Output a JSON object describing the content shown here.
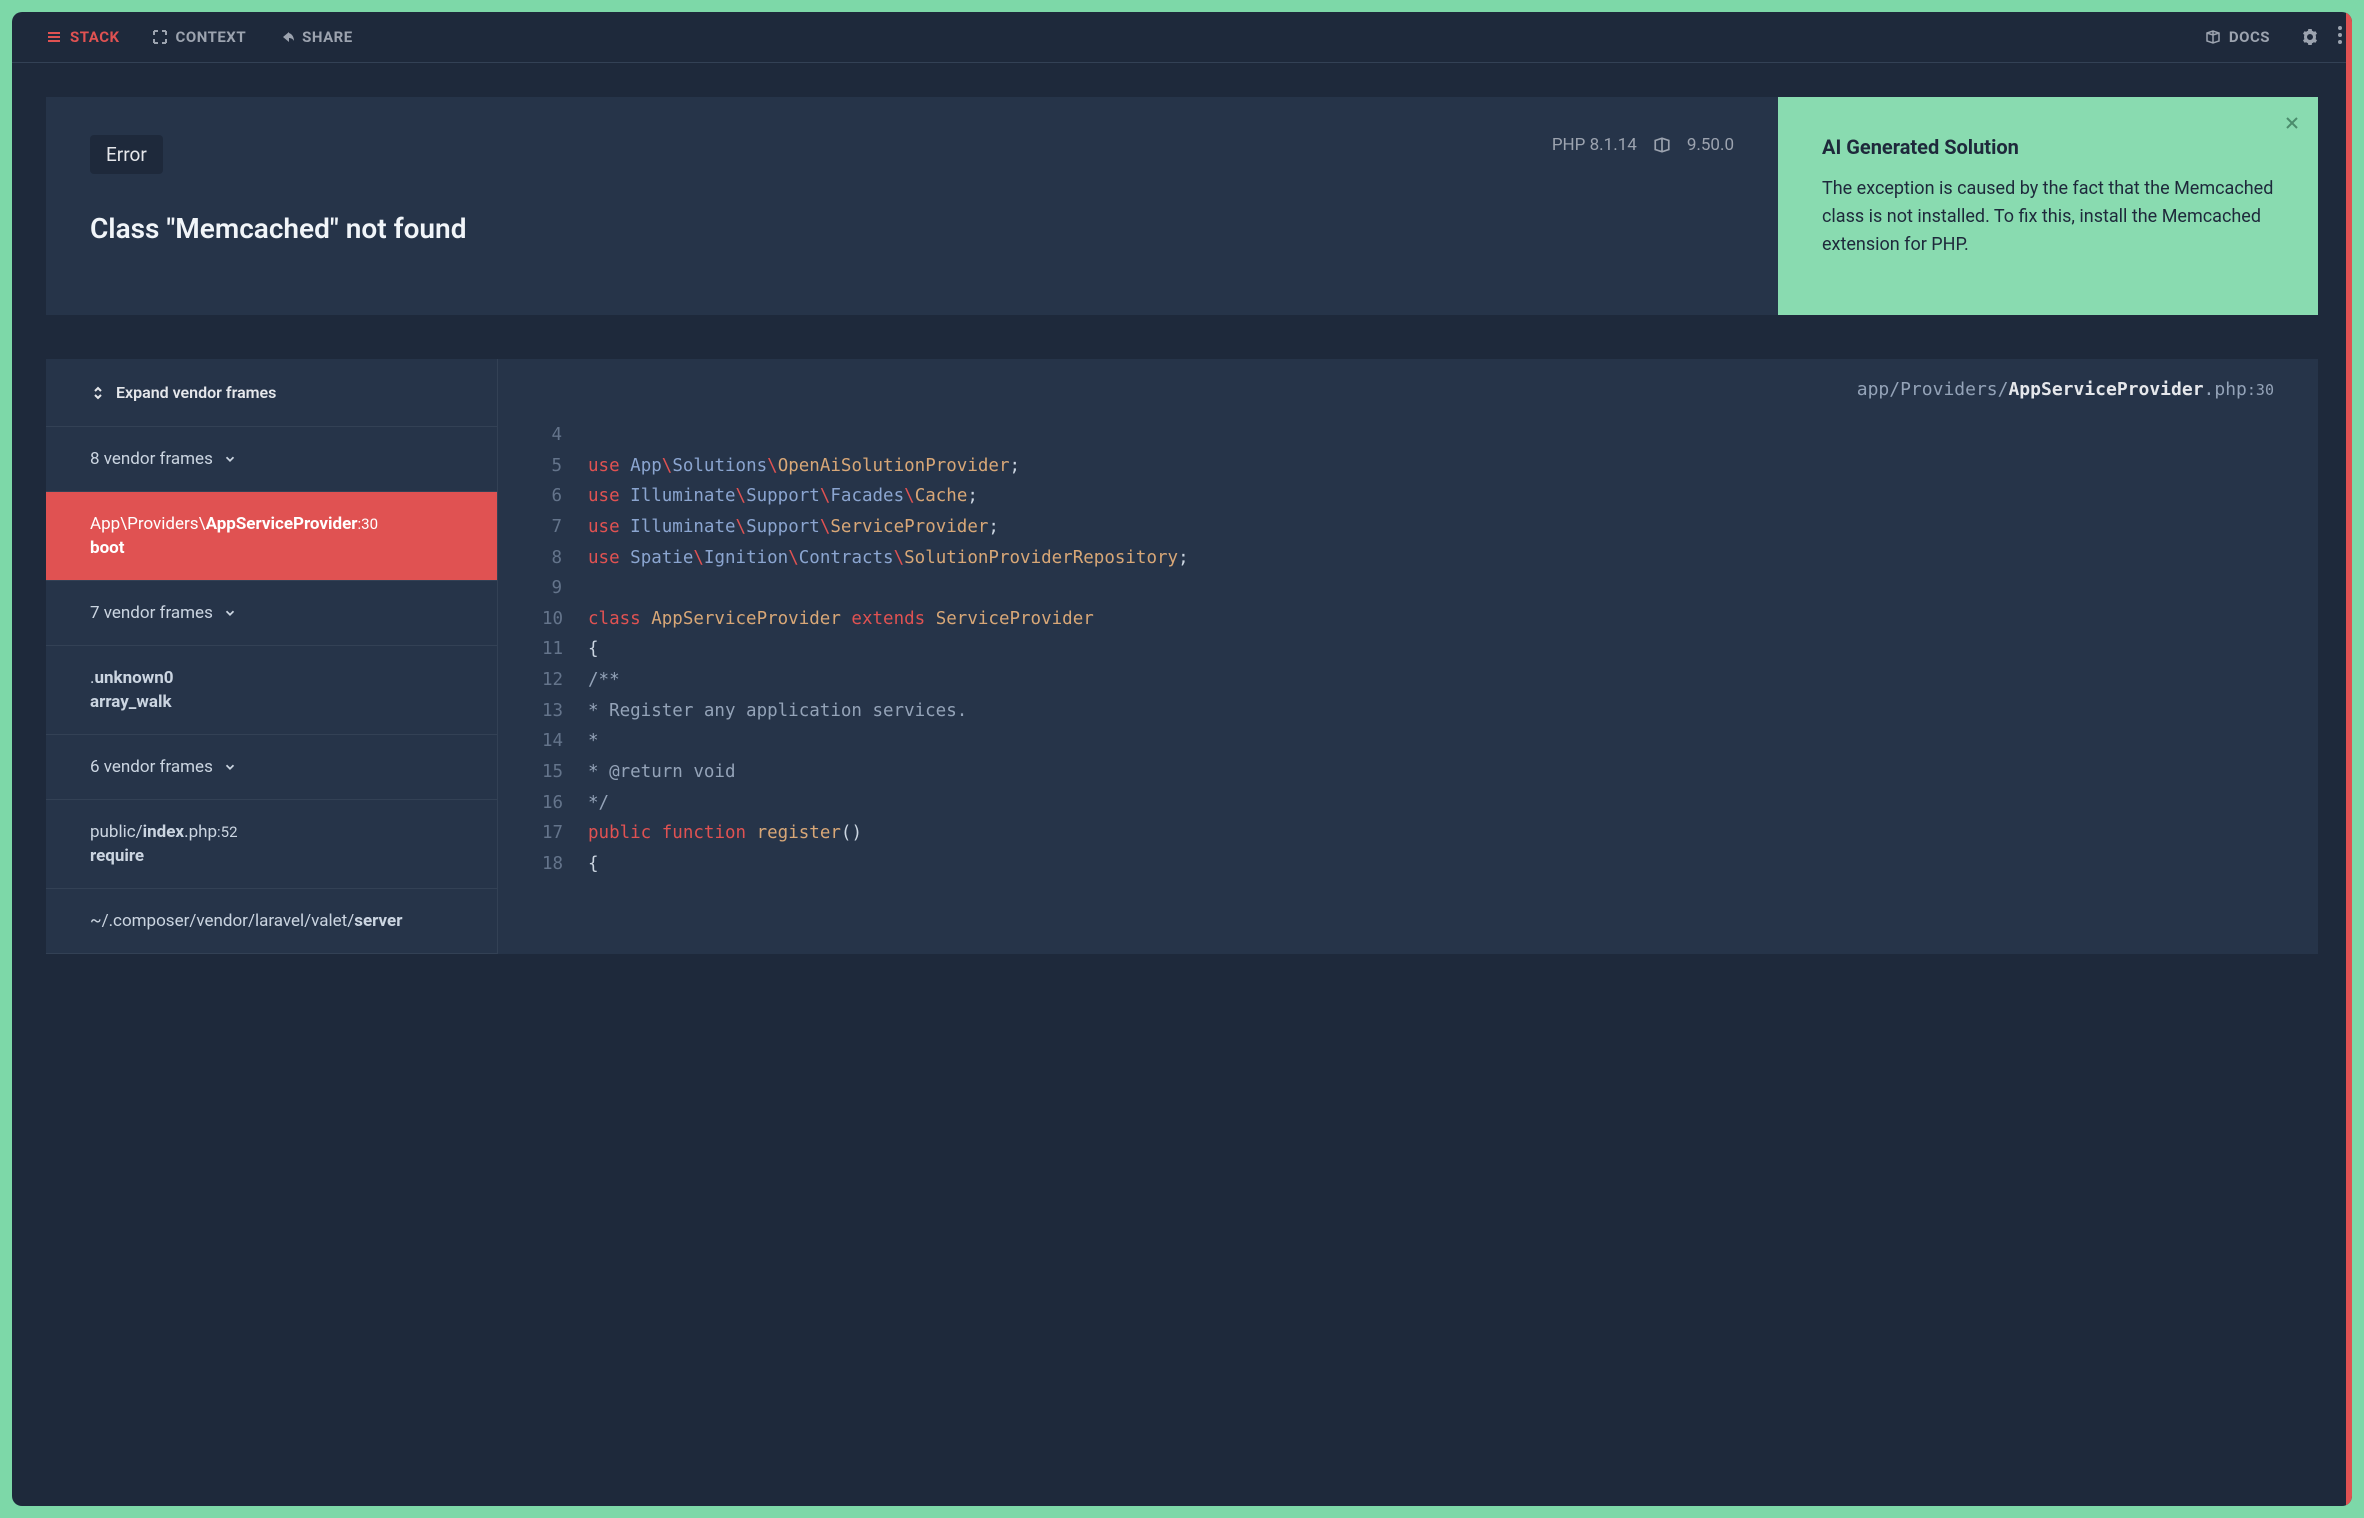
{
  "nav": {
    "stack": "STACK",
    "context": "CONTEXT",
    "share": "SHARE",
    "docs": "DOCS"
  },
  "error": {
    "badge": "Error",
    "php_version": "PHP 8.1.14",
    "laravel_version": "9.50.0",
    "title": "Class \"Memcached\" not found"
  },
  "solution": {
    "heading": "AI Generated Solution",
    "body": "The exception is caused by the fact that the Memcached class is not installed. To fix this, install the Memcached extension for PHP."
  },
  "frames": {
    "expand_label": "Expand vendor frames",
    "items": [
      {
        "type": "group",
        "label": "8 vendor frames"
      },
      {
        "type": "frame",
        "selected": true,
        "path_pre": "App\\",
        "path_mid": "Providers\\",
        "path_strong": "AppServiceProvider",
        "line": ":30",
        "func": "boot"
      },
      {
        "type": "group",
        "label": "7 vendor frames"
      },
      {
        "type": "frame",
        "path_pre": "",
        "path_mid": ".",
        "path_strong": "unknown0",
        "line": "",
        "func": "array_walk"
      },
      {
        "type": "group",
        "label": "6 vendor frames"
      },
      {
        "type": "frame",
        "path_pre": "public/",
        "path_mid": "",
        "path_strong": "index",
        "suffix": ".php",
        "line": ":52",
        "func": "require"
      },
      {
        "type": "frame",
        "path_pre": "~/.composer/vendor/laravel/valet/",
        "path_mid": "",
        "path_strong": "server",
        "suffix": "",
        "line": "",
        "func": ""
      }
    ]
  },
  "code": {
    "path_pre": "app/Providers/",
    "path_strong": "AppServiceProvider",
    "path_suffix": ".php",
    "path_line": ":30",
    "lines": [
      {
        "n": 4,
        "raw": ""
      },
      {
        "n": 5,
        "tokens": [
          [
            "kw",
            "use "
          ],
          [
            "ns",
            "App"
          ],
          [
            "bs",
            "\\"
          ],
          [
            "ns",
            "Solutions"
          ],
          [
            "bs",
            "\\"
          ],
          [
            "cls",
            "OpenAiSolutionProvider"
          ],
          [
            "punct",
            ";"
          ]
        ]
      },
      {
        "n": 6,
        "tokens": [
          [
            "kw",
            "use "
          ],
          [
            "ns",
            "Illuminate"
          ],
          [
            "bs",
            "\\"
          ],
          [
            "ns",
            "Support"
          ],
          [
            "bs",
            "\\"
          ],
          [
            "ns",
            "Facades"
          ],
          [
            "bs",
            "\\"
          ],
          [
            "cls",
            "Cache"
          ],
          [
            "punct",
            ";"
          ]
        ]
      },
      {
        "n": 7,
        "tokens": [
          [
            "kw",
            "use "
          ],
          [
            "ns",
            "Illuminate"
          ],
          [
            "bs",
            "\\"
          ],
          [
            "ns",
            "Support"
          ],
          [
            "bs",
            "\\"
          ],
          [
            "cls",
            "ServiceProvider"
          ],
          [
            "punct",
            ";"
          ]
        ]
      },
      {
        "n": 8,
        "tokens": [
          [
            "kw",
            "use "
          ],
          [
            "ns",
            "Spatie"
          ],
          [
            "bs",
            "\\"
          ],
          [
            "ns",
            "Ignition"
          ],
          [
            "bs",
            "\\"
          ],
          [
            "ns",
            "Contracts"
          ],
          [
            "bs",
            "\\"
          ],
          [
            "cls",
            "SolutionProviderRepository"
          ],
          [
            "punct",
            ";"
          ]
        ]
      },
      {
        "n": 9,
        "raw": ""
      },
      {
        "n": 10,
        "tokens": [
          [
            "kw",
            "class "
          ],
          [
            "cls",
            "AppServiceProvider"
          ],
          [
            "punct",
            " "
          ],
          [
            "kw",
            "extends"
          ],
          [
            "punct",
            " "
          ],
          [
            "cls",
            "ServiceProvider"
          ]
        ]
      },
      {
        "n": 11,
        "tokens": [
          [
            "punct",
            "{"
          ]
        ]
      },
      {
        "n": 12,
        "tokens": [
          [
            "com",
            "    /**"
          ]
        ]
      },
      {
        "n": 13,
        "tokens": [
          [
            "com",
            "     * Register any application services."
          ]
        ]
      },
      {
        "n": 14,
        "tokens": [
          [
            "com",
            "     *"
          ]
        ]
      },
      {
        "n": 15,
        "tokens": [
          [
            "com",
            "     * @return void"
          ]
        ]
      },
      {
        "n": 16,
        "tokens": [
          [
            "com",
            "     */"
          ]
        ]
      },
      {
        "n": 17,
        "tokens": [
          [
            "punct",
            "    "
          ],
          [
            "kw",
            "public"
          ],
          [
            "punct",
            " "
          ],
          [
            "kw",
            "function"
          ],
          [
            "punct",
            " "
          ],
          [
            "fn",
            "register"
          ],
          [
            "punct",
            "()"
          ]
        ]
      },
      {
        "n": 18,
        "tokens": [
          [
            "punct",
            "    {"
          ]
        ]
      }
    ]
  }
}
